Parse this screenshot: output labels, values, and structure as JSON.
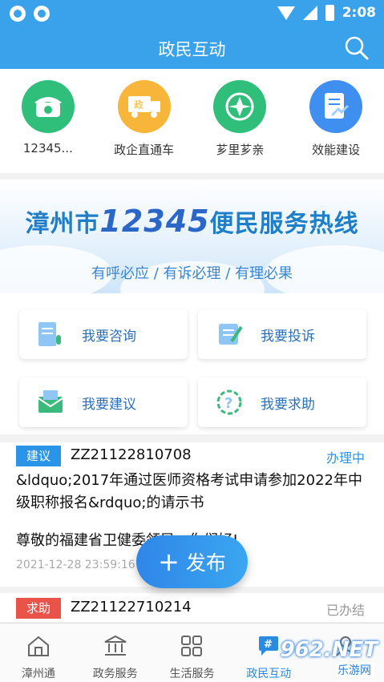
{
  "status_bar": {
    "time": "2:08"
  },
  "header": {
    "title": "政民互动"
  },
  "quick_links": [
    {
      "label": "12345...",
      "color": "#2fbf7a"
    },
    {
      "label": "政企直通车",
      "color": "#f7b53a"
    },
    {
      "label": "芗里芗亲",
      "color": "#2fbf7a"
    },
    {
      "label": "效能建设",
      "color": "#3f8ff0"
    }
  ],
  "banner": {
    "city": "漳州市",
    "number": "12345",
    "service": "便民服务热线",
    "tagline": "有呼必应 / 有诉必理 / 有理必果"
  },
  "actions": [
    {
      "label": "我要咨询"
    },
    {
      "label": "我要投诉"
    },
    {
      "label": "我要建议"
    },
    {
      "label": "我要求助"
    }
  ],
  "posts": [
    {
      "tag": "建议",
      "tag_color": "#2a95e8",
      "code": "ZZ21122810708",
      "status": "办理中",
      "status_color": "#2a95e8",
      "title": "&ldquo;2017年通过医师资格考试申请参加2022年中级职称报名&rdquo;的请示书",
      "body": "尊敬的福建省卫健委领导，你们好!",
      "date": "2021-12-28 23:59:16"
    },
    {
      "tag": "求助",
      "tag_color": "#e9534a",
      "code": "ZZ21122710214",
      "status": "已办结",
      "status_color": "#999999"
    }
  ],
  "fab": {
    "label": "发布"
  },
  "tabs": [
    {
      "label": "漳州通",
      "active": false
    },
    {
      "label": "政务服务",
      "active": false
    },
    {
      "label": "生活服务",
      "active": false
    },
    {
      "label": "政民互动",
      "active": true
    },
    {
      "label": "我的",
      "active": false
    }
  ],
  "watermark": {
    "top": "962.NET",
    "bottom": "乐游网"
  }
}
